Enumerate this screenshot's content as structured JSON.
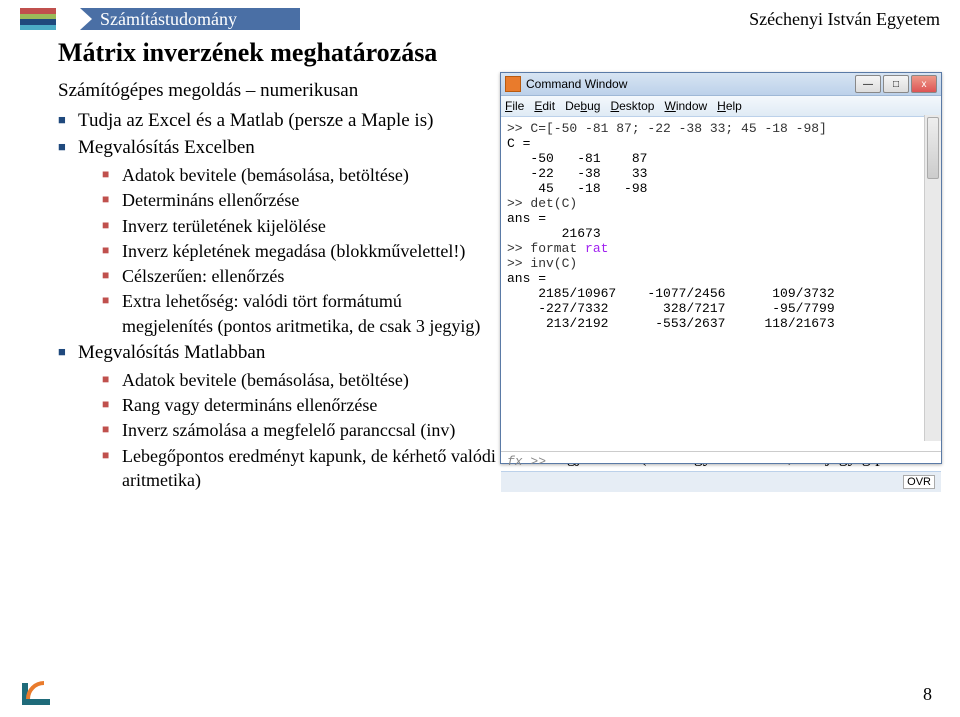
{
  "header": {
    "subject": "Számítástudomány",
    "university": "Széchenyi István Egyetem"
  },
  "title": "Mátrix inverzének meghatározása",
  "intro": "Számítógépes megoldás – numerikusan",
  "bullets": {
    "l1a": "Tudja az Excel és a Matlab (persze a Maple is)",
    "l1b": "Megvalósítás Excelben",
    "l2b": [
      "Adatok bevitele (bemásolása, betöltése)",
      "Determináns ellenőrzése",
      "Inverz területének kijelölése",
      "Inverz képletének megadása (blokkművelettel!)",
      "Célszerűen: ellenőrzés",
      "Extra lehetőség: valódi tört formátumú megjelenítés (pontos aritmetika, de csak 3 jegyig)"
    ],
    "l1c": "Megvalósítás Matlabban",
    "l2c": [
      "Adatok bevitele (bemásolása, betöltése)",
      "Rang vagy determináns ellenőrzése",
      "Inverz számolása a megfelelő paranccsal (inv)",
      "Lebegőpontos eredményt kapunk, de kérhető valódi törtes megjelenítés (rats vagy format rat; 5-6 jegyig pontos aritmetika)"
    ]
  },
  "matlab": {
    "title": "Command Window",
    "menu": {
      "file": "File",
      "edit": "Edit",
      "debug": "Debug",
      "desktop": "Desktop",
      "window": "Window",
      "help": "Help"
    },
    "btn_min": "—",
    "btn_max": "□",
    "btn_close": "x",
    "lines": {
      "l1": ">> C=[-50 -81 87; -22 -38 33; 45 -18 -98]",
      "l2": "C =",
      "l3": "   -50   -81    87",
      "l4": "   -22   -38    33",
      "l5": "    45   -18   -98",
      "l6": ">> det(C)",
      "l7": "ans =",
      "l8": "       21673",
      "l9a": ">> format ",
      "l9b": "rat",
      "l10": ">> inv(C)",
      "l11": "ans =",
      "l12": "    2185/10967    -1077/2456      109/3732",
      "l13": "    -227/7332       328/7217      -95/7799",
      "l14": "     213/2192      -553/2637     118/21673"
    },
    "fx": "fx  >>",
    "ovr": "OVR"
  },
  "page_number": "8"
}
